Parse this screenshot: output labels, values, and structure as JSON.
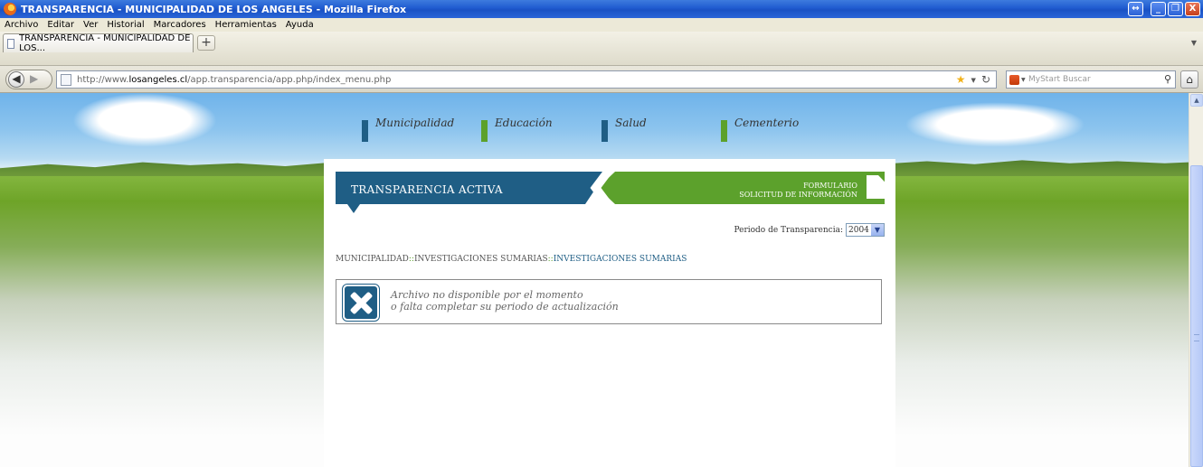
{
  "window": {
    "title": "TRANSPARENCIA - MUNICIPALIDAD DE LOS ANGELES - Mozilla Firefox",
    "controls": [
      "↔",
      "_",
      "❐",
      "X"
    ]
  },
  "menu": [
    "Archivo",
    "Editar",
    "Ver",
    "Historial",
    "Marcadores",
    "Herramientas",
    "Ayuda"
  ],
  "tab": {
    "label": "TRANSPARENCIA - MUNICIPALIDAD DE LOS...",
    "new_tab": "+"
  },
  "navbar": {
    "url_prefix": "http://www.",
    "url_domain": "losangeles.cl",
    "url_path": "/app.transparencia/app.php/index_menu.php",
    "search_placeholder": "MyStart Buscar"
  },
  "site_nav": [
    {
      "label": "Municipalidad",
      "color": "#1f5e85"
    },
    {
      "label": "Educación",
      "color": "#5ca12c"
    },
    {
      "label": "Salud",
      "color": "#1f5e85"
    },
    {
      "label": "Cementerio",
      "color": "#5ca12c"
    }
  ],
  "banner": {
    "title": "TRANSPARENCIA ACTIVA",
    "form_line1": "FORMULARIO",
    "form_line2": "SOLICITUD DE INFORMACIÓN"
  },
  "periodo": {
    "label": "Periodo de Transparencia:",
    "value": "2004"
  },
  "breadcrumb": {
    "part1": "MUNICIPALIDAD",
    "sep": "::",
    "part2": "INVESTIGACIONES SUMARIAS",
    "current": "INVESTIGACIONES SUMARIAS"
  },
  "alert": {
    "line1": "Archivo no disponible por el momento",
    "line2": "o falta completar su periodo de actualización"
  },
  "colors": {
    "brand_blue": "#1f5e85",
    "brand_green": "#5ca12c"
  }
}
